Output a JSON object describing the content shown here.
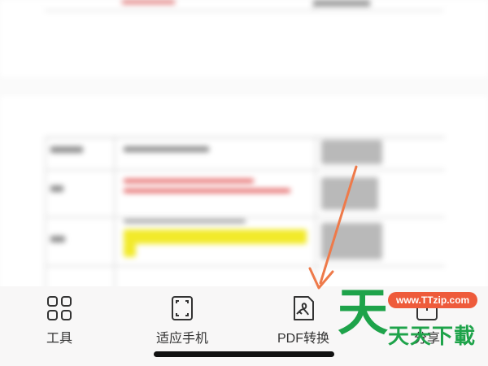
{
  "toolbar": {
    "items": [
      {
        "label": "工具",
        "icon": "apps-grid-icon"
      },
      {
        "label": "适应手机",
        "icon": "fit-screen-icon"
      },
      {
        "label": "PDF转换",
        "icon": "pdf-convert-icon"
      },
      {
        "label": "分享",
        "icon": "share-icon"
      }
    ]
  },
  "watermark": {
    "url": "www.TTzip.com",
    "logo_glyph": "天",
    "name": "天天下載"
  },
  "colors": {
    "arrow": "#ee7a4a",
    "watermark_green": "#1ea34a",
    "watermark_badge": "#ee5b3b",
    "toolbar_bg": "#f8f7f7"
  }
}
